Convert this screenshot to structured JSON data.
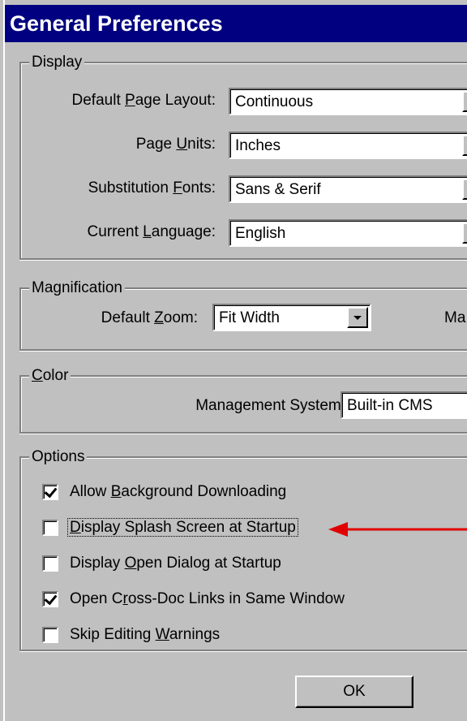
{
  "window": {
    "title": "General Preferences"
  },
  "display": {
    "legend": "Display",
    "rows": [
      {
        "label_pre": "Default ",
        "label_key": "P",
        "label_post": "age Layout:",
        "value": "Continuous"
      },
      {
        "label_pre": "Page ",
        "label_key": "U",
        "label_post": "nits:",
        "value": "Inches"
      },
      {
        "label_pre": "Substitution ",
        "label_key": "F",
        "label_post": "onts:",
        "value": "Sans & Serif"
      },
      {
        "label_pre": "Current ",
        "label_key": "L",
        "label_post": "anguage:",
        "value": "English"
      }
    ]
  },
  "magnification": {
    "legend": "Magnification",
    "zoom_label_pre": "Default ",
    "zoom_label_key": "Z",
    "zoom_label_post": "oom:",
    "zoom_value": "Fit Width",
    "cut_label": "Ma"
  },
  "color": {
    "legend_key": "C",
    "legend_rest": "olor",
    "mgmt_label": "Management System:",
    "mgmt_value": "Built-in CMS"
  },
  "options": {
    "legend": "Options",
    "items": [
      {
        "pre": "Allow ",
        "key": "B",
        "post": "ackground Downloading",
        "checked": true
      },
      {
        "pre": "",
        "key": "D",
        "post": "isplay Splash Screen at Startup",
        "checked": false
      },
      {
        "pre": "Display ",
        "key": "O",
        "post": "pen Dialog at Startup",
        "checked": false
      },
      {
        "pre": "Open C",
        "key": "r",
        "post": "oss-Doc Links in Same Window",
        "checked": true
      },
      {
        "pre": "Skip Editing ",
        "key": "W",
        "post": "arnings",
        "checked": false
      }
    ]
  },
  "buttons": {
    "ok": "OK"
  },
  "colors": {
    "annotation_arrow": "#e00000",
    "titlebar": "#000080"
  }
}
